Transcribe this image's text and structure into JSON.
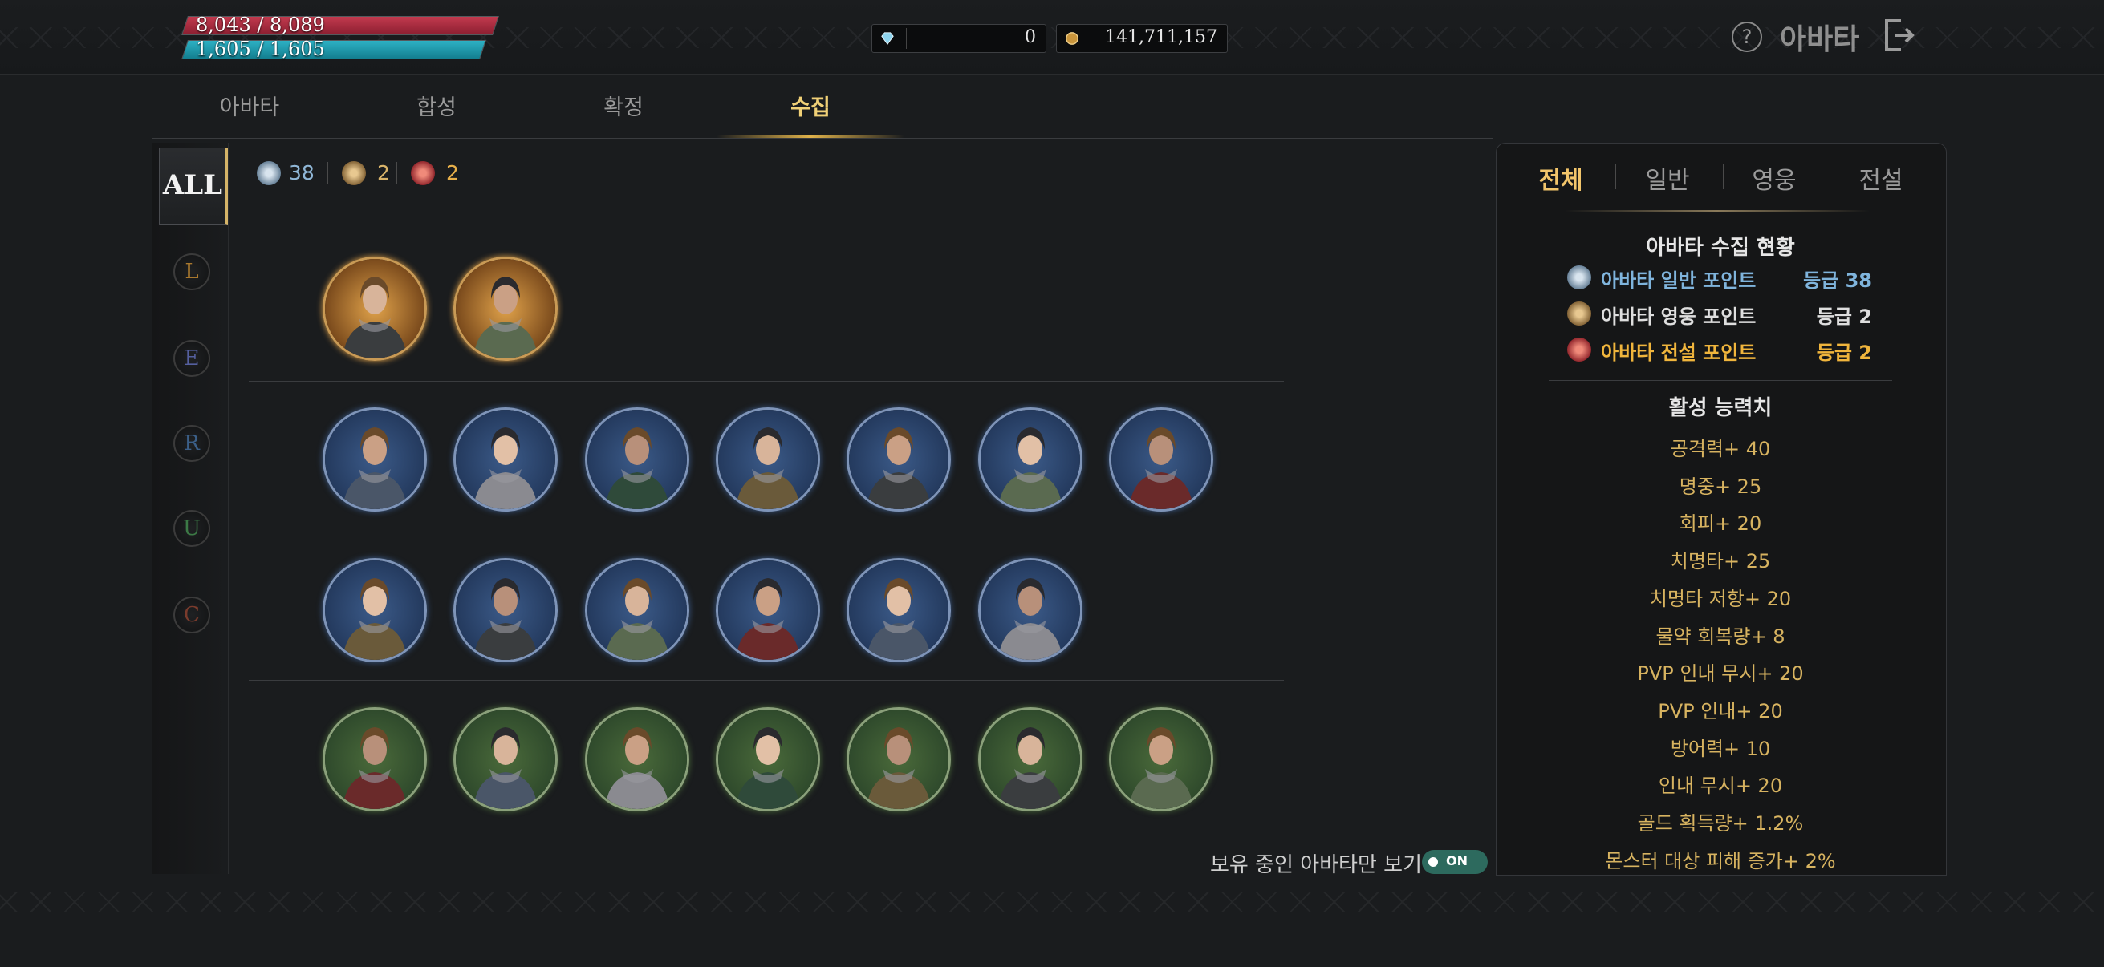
{
  "hud": {
    "hp_text": "8,043 / 8,089",
    "mp_text": "1,605 / 1,605",
    "hp_ratio": 0.994,
    "mp_ratio": 1.0,
    "diamond_value": "0",
    "gold_value": "141,711,157",
    "title": "아바타",
    "help_glyph": "?"
  },
  "tabs": [
    {
      "label": "아바타",
      "active": false
    },
    {
      "label": "합성",
      "active": false
    },
    {
      "label": "확정",
      "active": false
    },
    {
      "label": "수집",
      "active": true
    }
  ],
  "grade_filter": {
    "all_label": "ALL",
    "grades": [
      {
        "label": "L",
        "color": "#a8782e"
      },
      {
        "label": "E",
        "color": "#5560a0"
      },
      {
        "label": "R",
        "color": "#3b5f88"
      },
      {
        "label": "U",
        "color": "#3c7a46"
      },
      {
        "label": "C",
        "color": "#7a3b2c"
      }
    ]
  },
  "counts": [
    {
      "value": "38",
      "color": "#8fb6d6"
    },
    {
      "value": "2",
      "color": "#d9b46a"
    },
    {
      "value": "2",
      "color": "#e8b04a"
    }
  ],
  "collection": {
    "rows": [
      {
        "tier": "legend",
        "count": 2
      },
      {
        "tier": "hero",
        "count": 7
      },
      {
        "tier": "hero",
        "count": 6
      },
      {
        "tier": "normal",
        "count": 7
      }
    ],
    "owned_only_label": "보유 중인 아바타만 보기",
    "toggle_label": "ON"
  },
  "panel": {
    "tabs": [
      {
        "label": "전체",
        "active": true
      },
      {
        "label": "일반",
        "active": false
      },
      {
        "label": "영웅",
        "active": false
      },
      {
        "label": "전설",
        "active": false
      }
    ],
    "status_title": "아바타 수집 현황",
    "points": [
      {
        "label": "아바타 일반 포인트",
        "value": "등급 38",
        "color": "#7fb4dc"
      },
      {
        "label": "아바타 영웅 포인트",
        "value": "등급 2",
        "color": "#dedede"
      },
      {
        "label": "아바타 전설 포인트",
        "value": "등급 2",
        "color": "#f0b53c"
      }
    ],
    "active_title": "활성 능력치",
    "stats": [
      "공격력+ 40",
      "명중+ 25",
      "회피+ 20",
      "치명타+ 25",
      "치명타 저항+ 20",
      "물약 회복량+ 8",
      "PVP 인내 무시+ 20",
      "PVP 인내+ 20",
      "방어력+ 10",
      "인내 무시+ 20",
      "골드 획득량+ 1.2%",
      "몬스터 대상 피해 증가+ 2%"
    ]
  },
  "colors": {
    "accent_gold": "#f0d077",
    "hp": "#c23a4e",
    "mp": "#2db1c4",
    "stat_text": "#d7b360"
  }
}
